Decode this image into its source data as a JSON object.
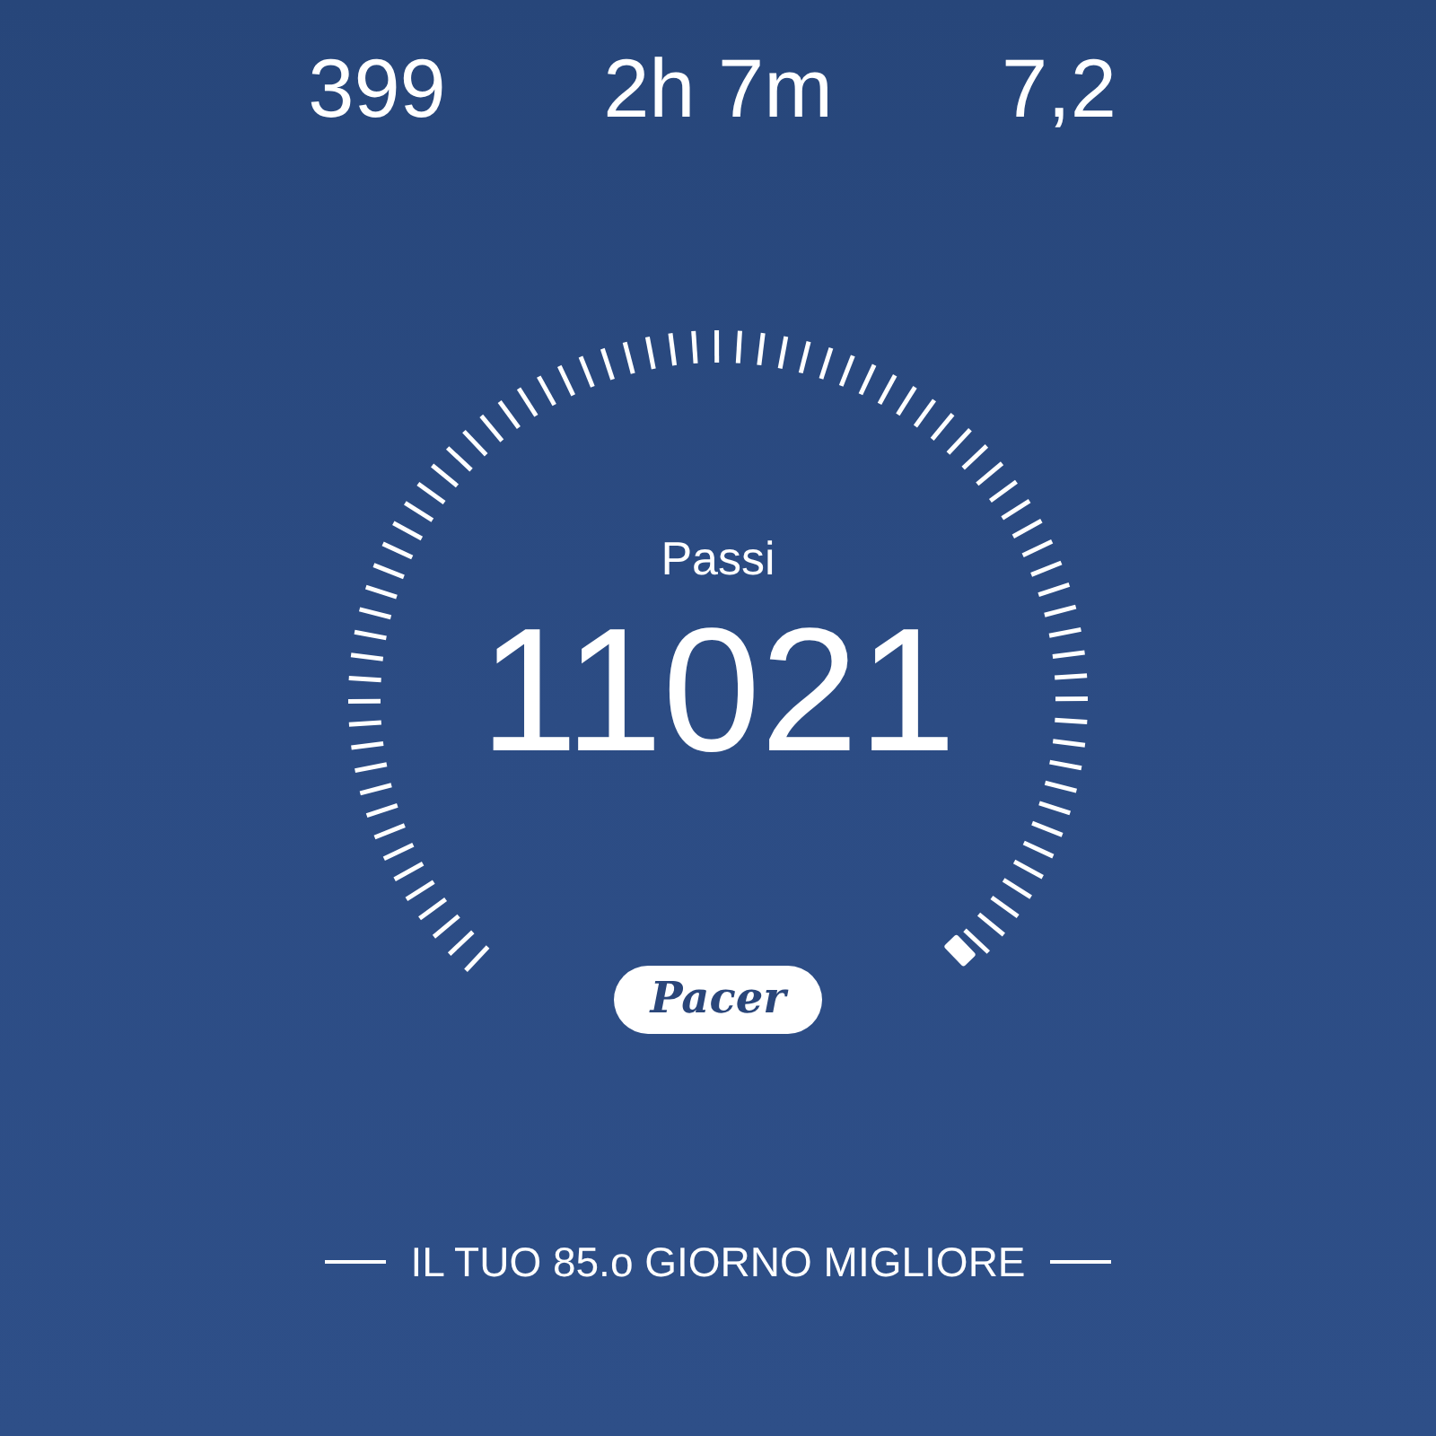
{
  "stats": [
    {
      "value": "399"
    },
    {
      "value": "2h 7m"
    },
    {
      "value": "7,2"
    }
  ],
  "gauge": {
    "label": "Passi",
    "value": "11021"
  },
  "logo": {
    "text": "Pacer"
  },
  "banner": {
    "text": "IL TUO 85.o GIORNO MIGLIORE"
  }
}
